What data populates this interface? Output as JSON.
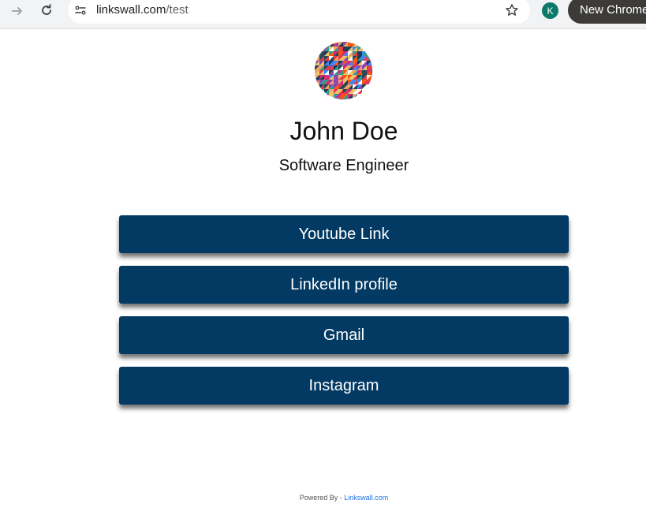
{
  "browser": {
    "url_host": "linkswall.com",
    "url_path": "/test",
    "profile_initial": "K",
    "new_chrome_label": "New Chrome",
    "icons": [
      "forward-arrow-icon",
      "reload-icon",
      "site-info-icon",
      "star-icon"
    ]
  },
  "profile": {
    "name": "John Doe",
    "title": "Software Engineer"
  },
  "links": [
    {
      "label": "Youtube Link"
    },
    {
      "label": "LinkedIn profile"
    },
    {
      "label": "Gmail"
    },
    {
      "label": "Instagram"
    }
  ],
  "footer": {
    "prefix": "Powered By - ",
    "link_text": "Linkswall.com"
  },
  "colors": {
    "button_bg": "#033a63",
    "button_text": "#ffffff",
    "footer_link": "#1a73e8"
  }
}
